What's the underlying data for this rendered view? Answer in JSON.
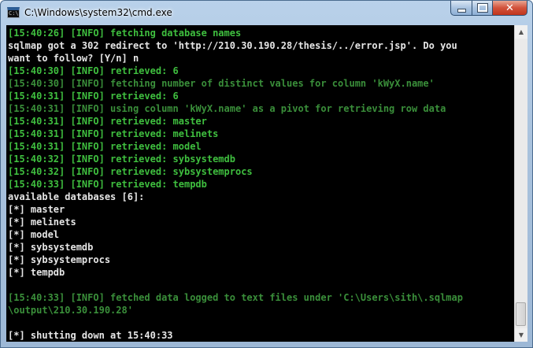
{
  "window": {
    "title": "C:\\Windows\\system32\\cmd.exe",
    "icon_name": "cmd-icon",
    "icon_text": "C:\\"
  },
  "controls": {
    "minimize": "minimize-icon",
    "maximize": "maximize-icon",
    "close_label": "✕"
  },
  "colors": {
    "console_bg": "#000000",
    "text_white": "#e6e6e6",
    "text_green": "#3fbf3f"
  },
  "console": {
    "lines": [
      {
        "text": "[15:40:26] [INFO] fetching database names",
        "color": "green"
      },
      {
        "text": "sqlmap got a 302 redirect to 'http://210.30.190.28/thesis/../error.jsp'. Do you",
        "color": "white"
      },
      {
        "text": "want to follow? [Y/n] n",
        "color": "white"
      },
      {
        "text": "[15:40:30] [INFO] retrieved: 6",
        "color": "green"
      },
      {
        "text": "[15:40:30] [INFO] fetching number of distinct values for column 'kWyX.name'",
        "color": "dim"
      },
      {
        "text": "[15:40:31] [INFO] retrieved: 6",
        "color": "green"
      },
      {
        "text": "[15:40:31] [INFO] using column 'kWyX.name' as a pivot for retrieving row data",
        "color": "dim"
      },
      {
        "text": "[15:40:31] [INFO] retrieved: master",
        "color": "green"
      },
      {
        "text": "[15:40:31] [INFO] retrieved: melinets",
        "color": "green"
      },
      {
        "text": "[15:40:31] [INFO] retrieved: model",
        "color": "green"
      },
      {
        "text": "[15:40:32] [INFO] retrieved: sybsystemdb",
        "color": "green"
      },
      {
        "text": "[15:40:32] [INFO] retrieved: sybsystemprocs",
        "color": "green"
      },
      {
        "text": "[15:40:33] [INFO] retrieved: tempdb",
        "color": "green"
      },
      {
        "text": "available databases [6]:",
        "color": "white"
      },
      {
        "text": "[*] master",
        "color": "white"
      },
      {
        "text": "[*] melinets",
        "color": "white"
      },
      {
        "text": "[*] model",
        "color": "white"
      },
      {
        "text": "[*] sybsystemdb",
        "color": "white"
      },
      {
        "text": "[*] sybsystemprocs",
        "color": "white"
      },
      {
        "text": "[*] tempdb",
        "color": "white"
      },
      {
        "text": "",
        "color": "white"
      },
      {
        "text": "[15:40:33] [INFO] fetched data logged to text files under 'C:\\Users\\sith\\.sqlmap",
        "color": "dim"
      },
      {
        "text": "\\output\\210.30.190.28'",
        "color": "dim"
      },
      {
        "text": "",
        "color": "white"
      },
      {
        "text": "[*] shutting down at 15:40:33",
        "color": "white"
      }
    ]
  },
  "scrollbar": {
    "up_arrow": "▲",
    "down_arrow": "▼"
  }
}
